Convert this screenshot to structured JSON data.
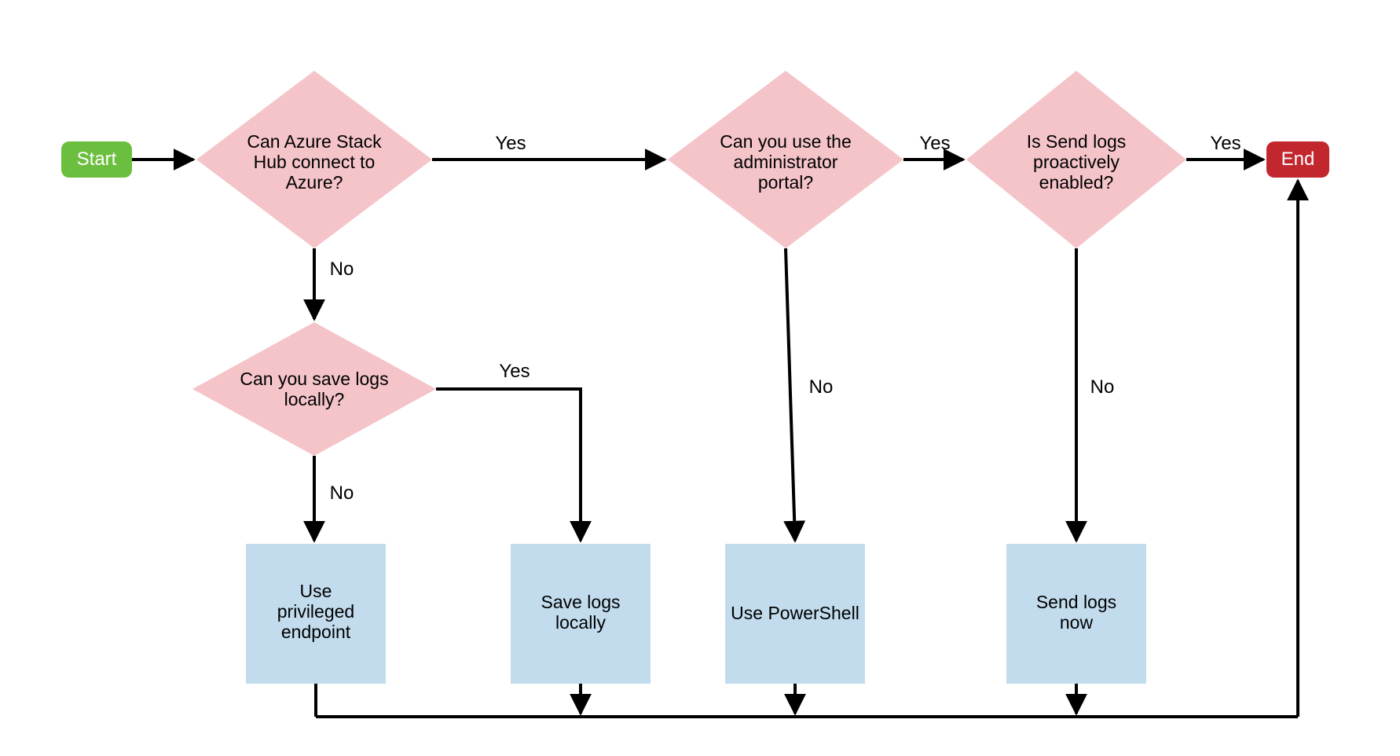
{
  "nodes": {
    "start": {
      "label": "Start"
    },
    "end": {
      "label": "End"
    },
    "d1": {
      "line1": "Can Azure Stack",
      "line2": "Hub connect to",
      "line3": "Azure?"
    },
    "d2": {
      "line1": "Can you use the",
      "line2": "administrator",
      "line3": "portal?"
    },
    "d3": {
      "line1": "Is Send logs",
      "line2": "proactively",
      "line3": "enabled?"
    },
    "d4": {
      "line1": "Can you save logs",
      "line2": "locally?"
    },
    "p1": {
      "line1": "Use",
      "line2": "privileged",
      "line3": "endpoint"
    },
    "p2": {
      "line1": "Save logs",
      "line2": "locally"
    },
    "p3": {
      "line1": "Use PowerShell"
    },
    "p4": {
      "line1": "Send logs",
      "line2": "now"
    }
  },
  "edges": {
    "yes": "Yes",
    "no": "No"
  },
  "colors": {
    "start": "#6cbf3e",
    "end": "#c1272d",
    "decision": "#f4c4c9",
    "process": "#c2dcee",
    "line": "#000000"
  }
}
